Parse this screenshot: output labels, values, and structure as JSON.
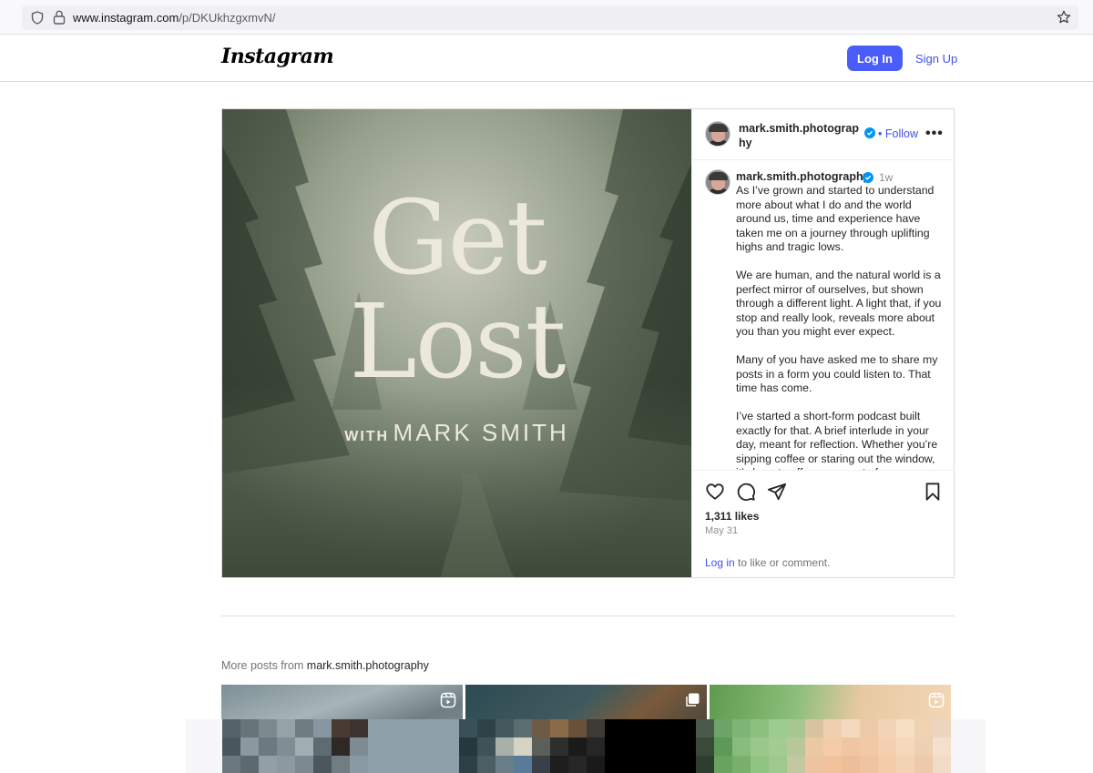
{
  "browser": {
    "url_host": "www.instagram.com",
    "url_path": "/p/DKUkhzgxmvN/"
  },
  "header": {
    "logo": "Instagram",
    "login_label": "Log In",
    "signup_label": "Sign Up",
    "accent": "#4a5df9"
  },
  "post": {
    "cover": {
      "line1": "Get",
      "line2": "Lost",
      "with": "WITH",
      "name": "MARK SMITH"
    },
    "header_username": "mark.smith.photography",
    "follow_label": "Follow",
    "follow_separator": "•",
    "more_label": "•••",
    "caption_username": "mark.smith.photography",
    "time": "1w",
    "caption": [
      "As I’ve grown and started to understand more about what I do and the world around us, time and experience have taken me on a journey through uplifting highs and tragic lows.",
      "We are human, and the natural world is a perfect mirror of ourselves, but shown through a different light. A light that, if you stop and really look, reveals more about you than you might ever expect.",
      "Many of you have asked me to share my posts in a form you could listen to. That time has come.",
      "I’ve started a short-form podcast built exactly for that. A brief interlude in your day, meant for reflection. Whether you’re sipping coffee or staring out the window, it’s here to offer a moment of pause."
    ],
    "likes": "1,311 likes",
    "date": "May 31",
    "login_link": "Log in",
    "login_suffix": " to like or comment."
  },
  "more_posts": {
    "prefix": "More posts from ",
    "username": "mark.smith.photography"
  }
}
